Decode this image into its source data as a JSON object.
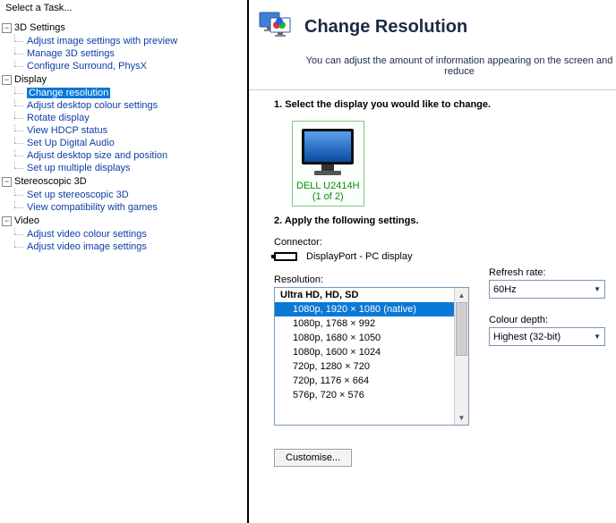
{
  "sidebar": {
    "header": "Select a Task...",
    "groups": [
      {
        "label": "3D Settings",
        "items": [
          "Adjust image settings with preview",
          "Manage 3D settings",
          "Configure Surround, PhysX"
        ]
      },
      {
        "label": "Display",
        "items": [
          "Change resolution",
          "Adjust desktop colour settings",
          "Rotate display",
          "View HDCP status",
          "Set Up Digital Audio",
          "Adjust desktop size and position",
          "Set up multiple displays"
        ],
        "selected": 0
      },
      {
        "label": "Stereoscopic 3D",
        "items": [
          "Set up stereoscopic 3D",
          "View compatibility with games"
        ]
      },
      {
        "label": "Video",
        "items": [
          "Adjust video colour settings",
          "Adjust video image settings"
        ]
      }
    ]
  },
  "page": {
    "title": "Change Resolution",
    "subtitle": "You can adjust the amount of information appearing on the screen and reduce"
  },
  "step1": {
    "heading": "1. Select the display you would like to change.",
    "monitor": {
      "name": "DELL U2414H",
      "sub": "(1 of 2)"
    }
  },
  "step2": {
    "heading": "2. Apply the following settings.",
    "connector_label": "Connector:",
    "connector_value": "DisplayPort - PC display",
    "resolution_label": "Resolution:",
    "res_group": "Ultra HD, HD, SD",
    "res_items": [
      "1080p, 1920 × 1080 (native)",
      "1080p, 1768 × 992",
      "1080p, 1680 × 1050",
      "1080p, 1600 × 1024",
      "720p, 1280 × 720",
      "720p, 1176 × 664",
      "576p, 720 × 576"
    ],
    "res_selected": 0,
    "refresh_label": "Refresh rate:",
    "refresh_value": "60Hz",
    "depth_label": "Colour depth:",
    "depth_value": "Highest (32-bit)",
    "customise_label": "Customise..."
  }
}
